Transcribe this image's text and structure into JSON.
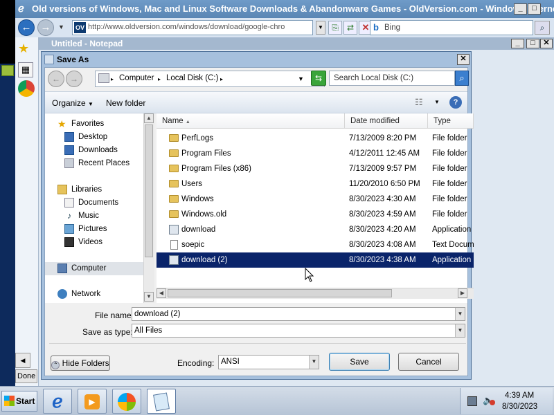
{
  "ie": {
    "title": "Old versions of Windows, Mac and Linux Software Downloads & Abandonware Games - OldVersion.com - Windows Internet Explorer",
    "address": "http://www.oldversion.com/windows/download/google-chro",
    "favicon_text": "OV",
    "search_engine": "Bing",
    "status": "Done"
  },
  "notepad": {
    "title": "Untitled - Notepad"
  },
  "dialog": {
    "title": "Save As",
    "breadcrumb": [
      "Computer",
      "Local Disk (C:)"
    ],
    "search_placeholder": "Search Local Disk (C:)",
    "organize_label": "Organize",
    "new_folder_label": "New folder",
    "nav": {
      "favorites": "Favorites",
      "desktop": "Desktop",
      "downloads": "Downloads",
      "recent": "Recent Places",
      "libraries": "Libraries",
      "documents": "Documents",
      "music": "Music",
      "pictures": "Pictures",
      "videos": "Videos",
      "computer": "Computer",
      "network": "Network"
    },
    "columns": {
      "name": "Name",
      "date": "Date modified",
      "type": "Type"
    },
    "files": [
      {
        "name": "PerfLogs",
        "date": "7/13/2009 8:20 PM",
        "type": "File folder",
        "icon": "folder-icon"
      },
      {
        "name": "Program Files",
        "date": "4/12/2011 12:45 AM",
        "type": "File folder",
        "icon": "folder-icon"
      },
      {
        "name": "Program Files (x86)",
        "date": "7/13/2009 9:57 PM",
        "type": "File folder",
        "icon": "folder-icon"
      },
      {
        "name": "Users",
        "date": "11/20/2010 6:50 PM",
        "type": "File folder",
        "icon": "folder-icon"
      },
      {
        "name": "Windows",
        "date": "8/30/2023 4:30 AM",
        "type": "File folder",
        "icon": "folder-icon"
      },
      {
        "name": "Windows.old",
        "date": "8/30/2023 4:59 AM",
        "type": "File folder",
        "icon": "folder-icon"
      },
      {
        "name": "download",
        "date": "8/30/2023 4:20 AM",
        "type": "Application",
        "icon": "application-icon"
      },
      {
        "name": "soepic",
        "date": "8/30/2023 4:08 AM",
        "type": "Text Docume",
        "icon": "text-file-icon"
      },
      {
        "name": "download (2)",
        "date": "8/30/2023 4:38 AM",
        "type": "Application",
        "icon": "application-icon",
        "selected": true
      }
    ],
    "file_name_label": "File name:",
    "file_name_value": "download (2)",
    "save_type_label": "Save as type:",
    "save_type_value": "All Files",
    "hide_folders_label": "Hide Folders",
    "encoding_label": "Encoding:",
    "encoding_value": "ANSI",
    "save_label": "Save",
    "cancel_label": "Cancel"
  },
  "taskbar": {
    "start_label": "Start",
    "time": "4:39 AM",
    "date": "8/30/2023"
  },
  "colors": {
    "selection": "#0a246a",
    "titlebar": "#6f9bc8",
    "dialog_frame": "#a6c0dd"
  }
}
